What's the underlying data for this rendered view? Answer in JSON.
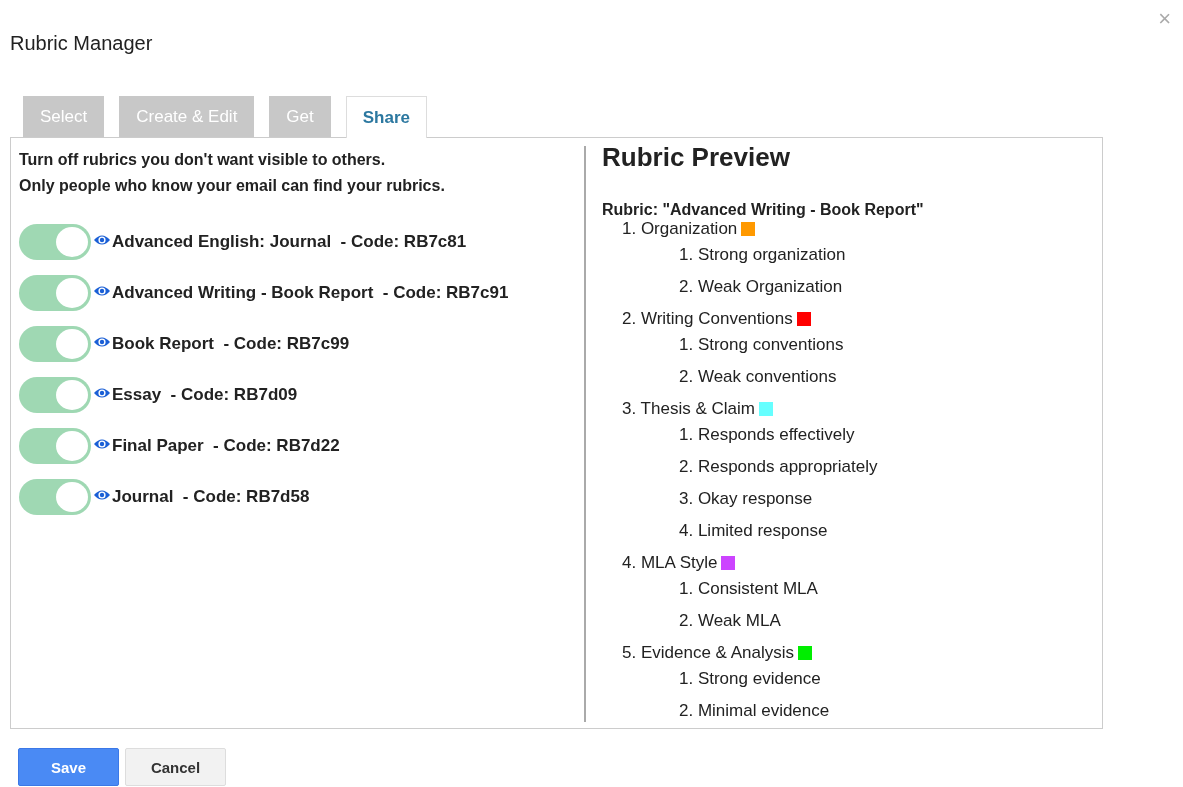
{
  "dialog": {
    "title": "Rubric Manager",
    "close": "×"
  },
  "tabs": [
    {
      "label": "Select",
      "selected": false
    },
    {
      "label": "Create & Edit",
      "selected": false
    },
    {
      "label": "Get",
      "selected": false
    },
    {
      "label": "Share",
      "selected": true
    }
  ],
  "share": {
    "intro": [
      "Turn off rubrics you don't want visible to others.",
      "Only people who know your email can find your rubrics."
    ],
    "rubrics": [
      {
        "label": "Advanced English: Journal  - Code: RB7c81",
        "on": true
      },
      {
        "label": "Advanced Writing - Book Report  - Code: RB7c91",
        "on": true
      },
      {
        "label": "Book Report  - Code: RB7c99",
        "on": true
      },
      {
        "label": "Essay  - Code: RB7d09",
        "on": true
      },
      {
        "label": "Final Paper  - Code: RB7d22",
        "on": true
      },
      {
        "label": "Journal  - Code: RB7d58",
        "on": true
      }
    ]
  },
  "preview": {
    "heading": "Rubric Preview",
    "rubric": "Rubric: \"Advanced Writing - Book Report\"",
    "criteria": [
      {
        "label": "1. Organization",
        "color": "#ff9900",
        "levels": [
          "1. Strong organization",
          "2. Weak Organization"
        ]
      },
      {
        "label": "2. Writing Conventions",
        "color": "#ff0000",
        "levels": [
          "1. Strong conventions",
          "2. Weak conventions"
        ]
      },
      {
        "label": "3. Thesis & Claim",
        "color": "#66ffff",
        "levels": [
          "1. Responds effectively",
          "2. Responds appropriately",
          "3. Okay response",
          "4. Limited response"
        ]
      },
      {
        "label": "4. MLA Style",
        "color": "#cc44ff",
        "levels": [
          "1. Consistent MLA",
          "2. Weak MLA"
        ]
      },
      {
        "label": "5. Evidence & Analysis",
        "color": "#00ee00",
        "levels": [
          "1. Strong evidence",
          "2. Minimal evidence"
        ]
      }
    ]
  },
  "buttons": [
    {
      "label": "Save",
      "kind": "primary"
    },
    {
      "label": "Cancel",
      "kind": "secondary"
    }
  ]
}
